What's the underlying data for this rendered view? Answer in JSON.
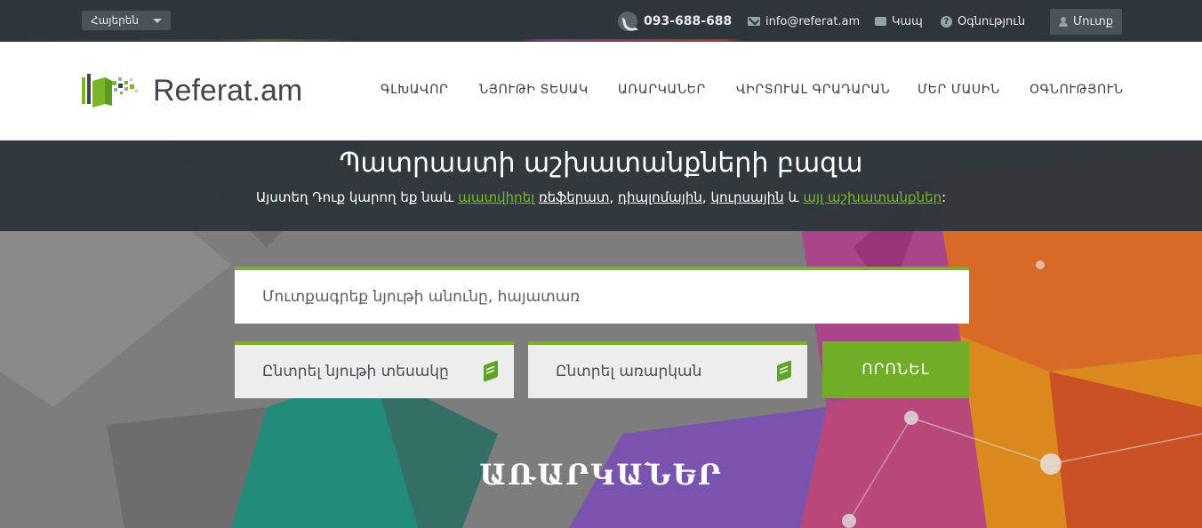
{
  "topbar": {
    "language": "Հայերեն",
    "phone": "093-688-688",
    "email": "info@referat.am",
    "contact_label": "Կապ",
    "help_label": "Օգնություն",
    "login_label": "Մուտք"
  },
  "header": {
    "logo_text": "Referat.am",
    "nav": [
      {
        "label": "ԳԼԽԱՎՈՐ"
      },
      {
        "label": "ՆՅՈՒԹԻ ՏԵՍԱԿ"
      },
      {
        "label": "ԱՌԱՐԿԱՆԵՐ"
      },
      {
        "label": "ՎԻՐՏՈՒԱԼ ԳՐԱԴԱՐԱՆ"
      },
      {
        "label": "ՄԵՐ ՄԱՍԻՆ"
      },
      {
        "label": "ՕԳՆՈՒԹՅՈՒՆ"
      }
    ]
  },
  "hero": {
    "title": "Պատրաստի աշխատանքների բազա",
    "subtitle": {
      "prefix": "Այստեղ Դուք կարող եք նաև ",
      "order_link": "պատվիրել",
      "referat": "ռեֆերատ",
      "diploma": "դիպլոմային",
      "coursework": "կուրսային",
      "and": " և ",
      "other_link": "այլ աշխատանքներ",
      "suffix": ":"
    },
    "search_placeholder": "Մուտքագրեք նյութի անունը, հայատառ",
    "select_type": "Ընտրել նյութի տեսակը",
    "select_subject": "Ընտրել առարկան",
    "search_button": "ՈՐՈՆԵԼ",
    "section_title": "ԱՌԱՐԿԱՆԵՐ"
  },
  "colors": {
    "accent": "#78b22d",
    "dark": "#2e353b"
  }
}
